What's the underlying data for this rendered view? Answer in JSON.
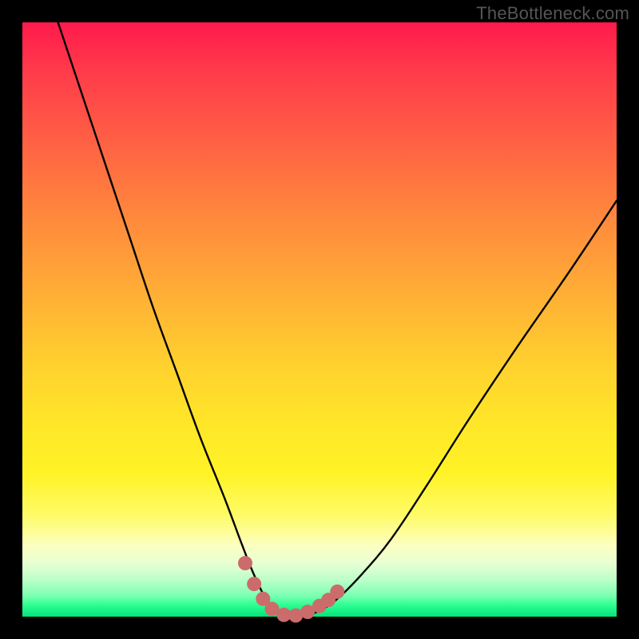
{
  "watermark": {
    "text": "TheBottleneck.com"
  },
  "colors": {
    "background": "#000000",
    "curve_stroke": "#000000",
    "marker_fill": "#cc6b6b",
    "gradient_top": "#ff1a4d",
    "gradient_bottom": "#00e47a"
  },
  "chart_data": {
    "type": "line",
    "title": "",
    "xlabel": "",
    "ylabel": "",
    "xlim": [
      0,
      100
    ],
    "ylim": [
      0,
      100
    ],
    "grid": false,
    "legend": "none",
    "series": [
      {
        "name": "bottleneck-curve",
        "x": [
          6,
          10,
          14,
          18,
          22,
          26,
          30,
          34,
          37,
          39,
          41,
          43,
          45,
          47,
          50,
          53,
          57,
          62,
          68,
          75,
          83,
          92,
          100
        ],
        "y": [
          100,
          88,
          76,
          64,
          52,
          41,
          30,
          20,
          12,
          7,
          3,
          1,
          0,
          0,
          1,
          3,
          7,
          13,
          22,
          33,
          45,
          58,
          70
        ]
      }
    ],
    "markers": {
      "name": "trough-markers",
      "x": [
        37.5,
        39,
        40.5,
        42,
        44,
        46,
        48,
        50,
        51.5,
        53
      ],
      "y": [
        9,
        5.5,
        3,
        1.3,
        0.3,
        0.2,
        0.8,
        1.8,
        2.8,
        4.2
      ]
    },
    "annotations": [
      {
        "text": "TheBottleneck.com",
        "position": "top-right"
      }
    ]
  }
}
